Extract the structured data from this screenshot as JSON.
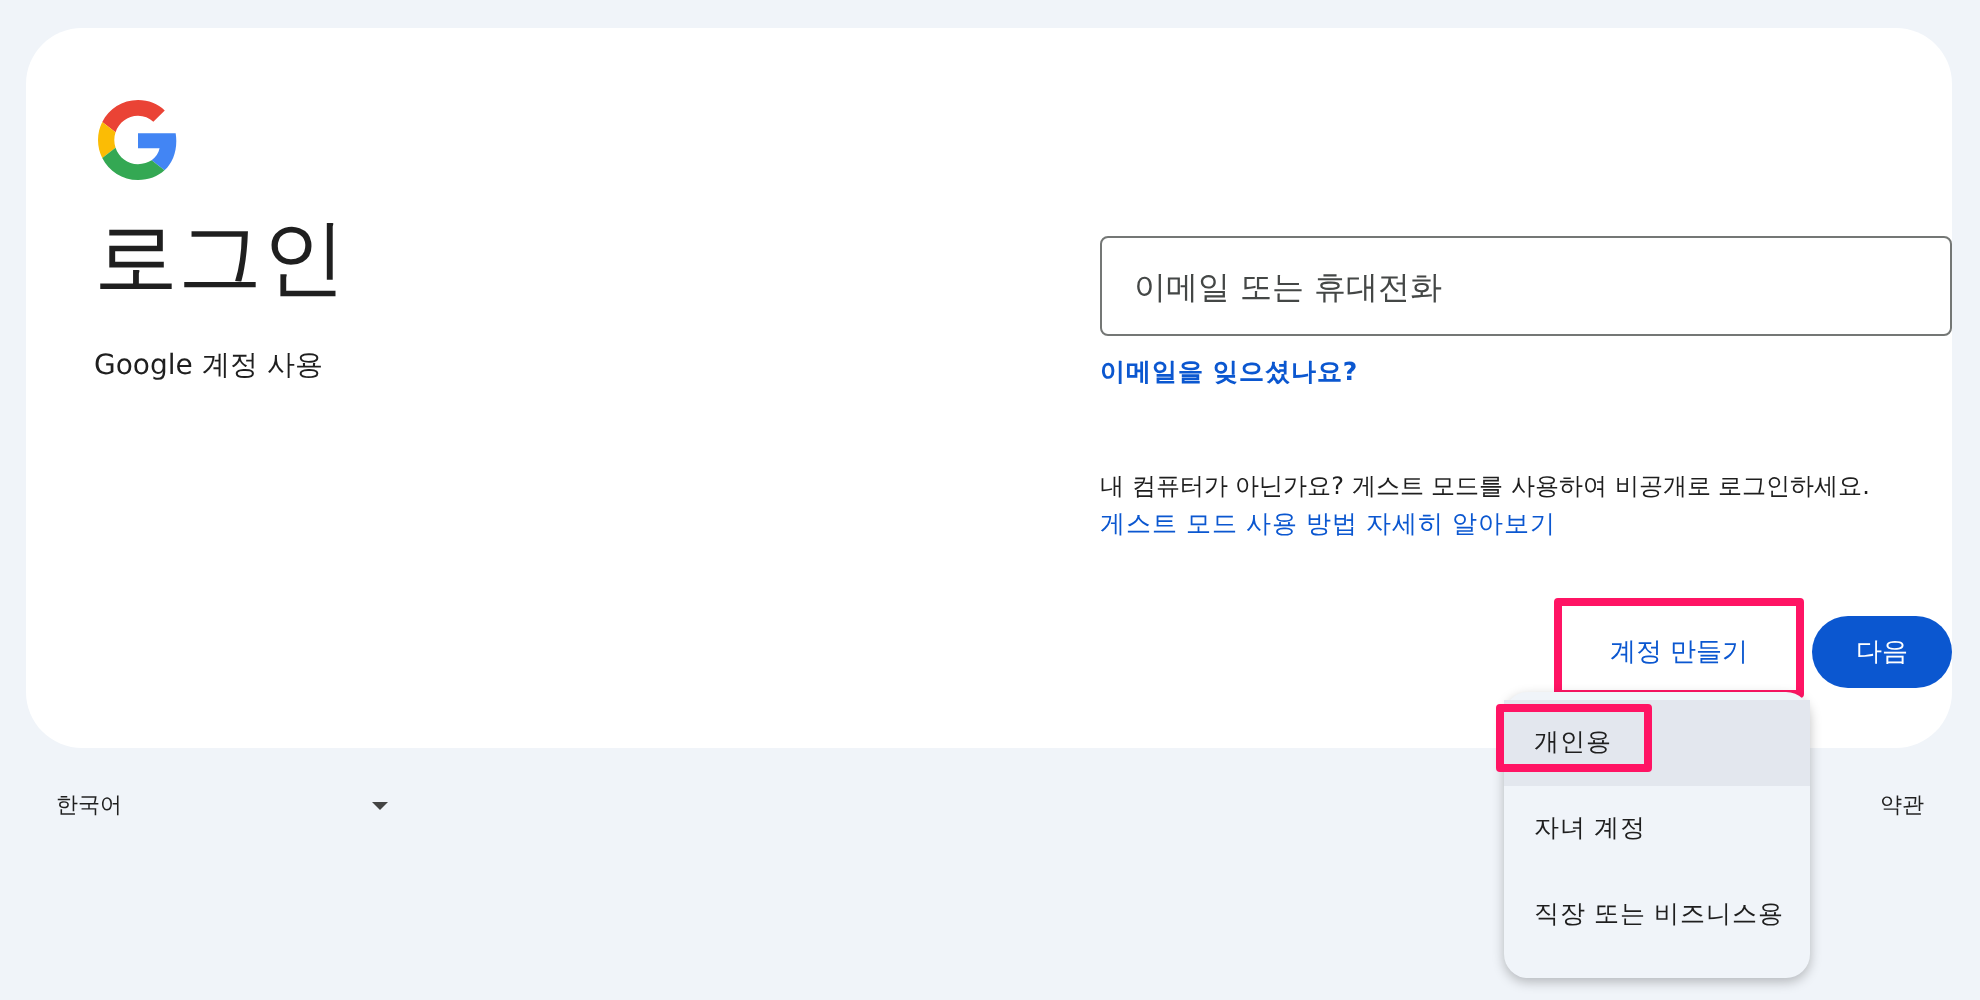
{
  "card": {
    "title": "로그인",
    "subtitle": "Google 계정 사용",
    "email_field": {
      "placeholder": "이메일 또는 휴대전화"
    },
    "forgot_link": "이메일을 잊으셨나요?",
    "guest_text": "내 컴퓨터가 아닌가요? 게스트 모드를 사용하여 비공개로 로그인하세요.",
    "guest_link": "게스트 모드 사용 방법 자세히 알아보기",
    "create_account": {
      "label": "계정 만들기",
      "highlighted": true
    },
    "next_button": "다음"
  },
  "account_menu": [
    {
      "label": "개인용",
      "selected": true,
      "highlighted": true
    },
    {
      "label": "자녀 계정",
      "selected": false,
      "highlighted": false
    },
    {
      "label": "직장 또는 비즈니스용",
      "selected": false,
      "highlighted": false
    }
  ],
  "footer": {
    "language": "한국어",
    "links": [
      "약관"
    ]
  }
}
